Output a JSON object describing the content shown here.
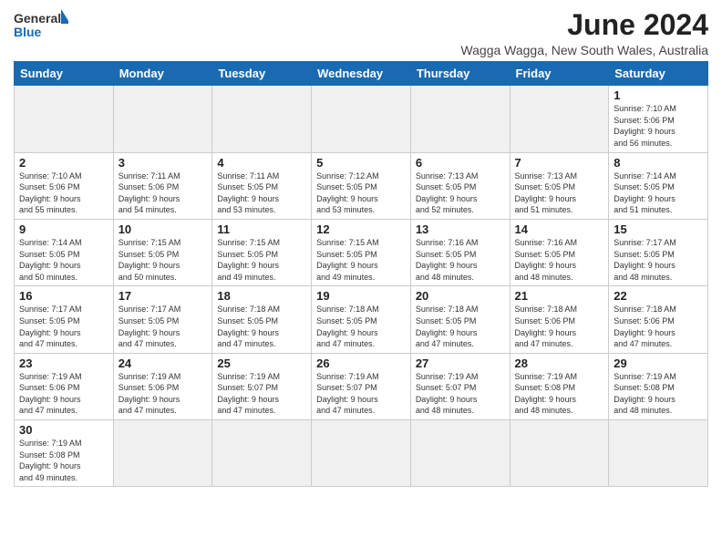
{
  "header": {
    "logo_general": "General",
    "logo_blue": "Blue",
    "month_year": "June 2024",
    "location": "Wagga Wagga, New South Wales, Australia"
  },
  "days_of_week": [
    "Sunday",
    "Monday",
    "Tuesday",
    "Wednesday",
    "Thursday",
    "Friday",
    "Saturday"
  ],
  "weeks": [
    [
      {
        "day": "",
        "info": "",
        "empty": true
      },
      {
        "day": "",
        "info": "",
        "empty": true
      },
      {
        "day": "",
        "info": "",
        "empty": true
      },
      {
        "day": "",
        "info": "",
        "empty": true
      },
      {
        "day": "",
        "info": "",
        "empty": true
      },
      {
        "day": "",
        "info": "",
        "empty": true
      },
      {
        "day": "1",
        "info": "Sunrise: 7:10 AM\nSunset: 5:06 PM\nDaylight: 9 hours\nand 56 minutes."
      }
    ],
    [
      {
        "day": "2",
        "info": "Sunrise: 7:10 AM\nSunset: 5:06 PM\nDaylight: 9 hours\nand 55 minutes."
      },
      {
        "day": "3",
        "info": "Sunrise: 7:11 AM\nSunset: 5:06 PM\nDaylight: 9 hours\nand 54 minutes."
      },
      {
        "day": "4",
        "info": "Sunrise: 7:11 AM\nSunset: 5:05 PM\nDaylight: 9 hours\nand 53 minutes."
      },
      {
        "day": "5",
        "info": "Sunrise: 7:12 AM\nSunset: 5:05 PM\nDaylight: 9 hours\nand 53 minutes."
      },
      {
        "day": "6",
        "info": "Sunrise: 7:13 AM\nSunset: 5:05 PM\nDaylight: 9 hours\nand 52 minutes."
      },
      {
        "day": "7",
        "info": "Sunrise: 7:13 AM\nSunset: 5:05 PM\nDaylight: 9 hours\nand 51 minutes."
      },
      {
        "day": "8",
        "info": "Sunrise: 7:14 AM\nSunset: 5:05 PM\nDaylight: 9 hours\nand 51 minutes."
      }
    ],
    [
      {
        "day": "9",
        "info": "Sunrise: 7:14 AM\nSunset: 5:05 PM\nDaylight: 9 hours\nand 50 minutes."
      },
      {
        "day": "10",
        "info": "Sunrise: 7:15 AM\nSunset: 5:05 PM\nDaylight: 9 hours\nand 50 minutes."
      },
      {
        "day": "11",
        "info": "Sunrise: 7:15 AM\nSunset: 5:05 PM\nDaylight: 9 hours\nand 49 minutes."
      },
      {
        "day": "12",
        "info": "Sunrise: 7:15 AM\nSunset: 5:05 PM\nDaylight: 9 hours\nand 49 minutes."
      },
      {
        "day": "13",
        "info": "Sunrise: 7:16 AM\nSunset: 5:05 PM\nDaylight: 9 hours\nand 48 minutes."
      },
      {
        "day": "14",
        "info": "Sunrise: 7:16 AM\nSunset: 5:05 PM\nDaylight: 9 hours\nand 48 minutes."
      },
      {
        "day": "15",
        "info": "Sunrise: 7:17 AM\nSunset: 5:05 PM\nDaylight: 9 hours\nand 48 minutes."
      }
    ],
    [
      {
        "day": "16",
        "info": "Sunrise: 7:17 AM\nSunset: 5:05 PM\nDaylight: 9 hours\nand 47 minutes."
      },
      {
        "day": "17",
        "info": "Sunrise: 7:17 AM\nSunset: 5:05 PM\nDaylight: 9 hours\nand 47 minutes."
      },
      {
        "day": "18",
        "info": "Sunrise: 7:18 AM\nSunset: 5:05 PM\nDaylight: 9 hours\nand 47 minutes."
      },
      {
        "day": "19",
        "info": "Sunrise: 7:18 AM\nSunset: 5:05 PM\nDaylight: 9 hours\nand 47 minutes."
      },
      {
        "day": "20",
        "info": "Sunrise: 7:18 AM\nSunset: 5:05 PM\nDaylight: 9 hours\nand 47 minutes."
      },
      {
        "day": "21",
        "info": "Sunrise: 7:18 AM\nSunset: 5:06 PM\nDaylight: 9 hours\nand 47 minutes."
      },
      {
        "day": "22",
        "info": "Sunrise: 7:18 AM\nSunset: 5:06 PM\nDaylight: 9 hours\nand 47 minutes."
      }
    ],
    [
      {
        "day": "23",
        "info": "Sunrise: 7:19 AM\nSunset: 5:06 PM\nDaylight: 9 hours\nand 47 minutes."
      },
      {
        "day": "24",
        "info": "Sunrise: 7:19 AM\nSunset: 5:06 PM\nDaylight: 9 hours\nand 47 minutes."
      },
      {
        "day": "25",
        "info": "Sunrise: 7:19 AM\nSunset: 5:07 PM\nDaylight: 9 hours\nand 47 minutes."
      },
      {
        "day": "26",
        "info": "Sunrise: 7:19 AM\nSunset: 5:07 PM\nDaylight: 9 hours\nand 47 minutes."
      },
      {
        "day": "27",
        "info": "Sunrise: 7:19 AM\nSunset: 5:07 PM\nDaylight: 9 hours\nand 48 minutes."
      },
      {
        "day": "28",
        "info": "Sunrise: 7:19 AM\nSunset: 5:08 PM\nDaylight: 9 hours\nand 48 minutes."
      },
      {
        "day": "29",
        "info": "Sunrise: 7:19 AM\nSunset: 5:08 PM\nDaylight: 9 hours\nand 48 minutes."
      }
    ],
    [
      {
        "day": "30",
        "info": "Sunrise: 7:19 AM\nSunset: 5:08 PM\nDaylight: 9 hours\nand 49 minutes.",
        "last": true
      },
      {
        "day": "",
        "info": "",
        "empty": true,
        "last": true
      },
      {
        "day": "",
        "info": "",
        "empty": true,
        "last": true
      },
      {
        "day": "",
        "info": "",
        "empty": true,
        "last": true
      },
      {
        "day": "",
        "info": "",
        "empty": true,
        "last": true
      },
      {
        "day": "",
        "info": "",
        "empty": true,
        "last": true
      },
      {
        "day": "",
        "info": "",
        "empty": true,
        "last": true
      }
    ]
  ]
}
